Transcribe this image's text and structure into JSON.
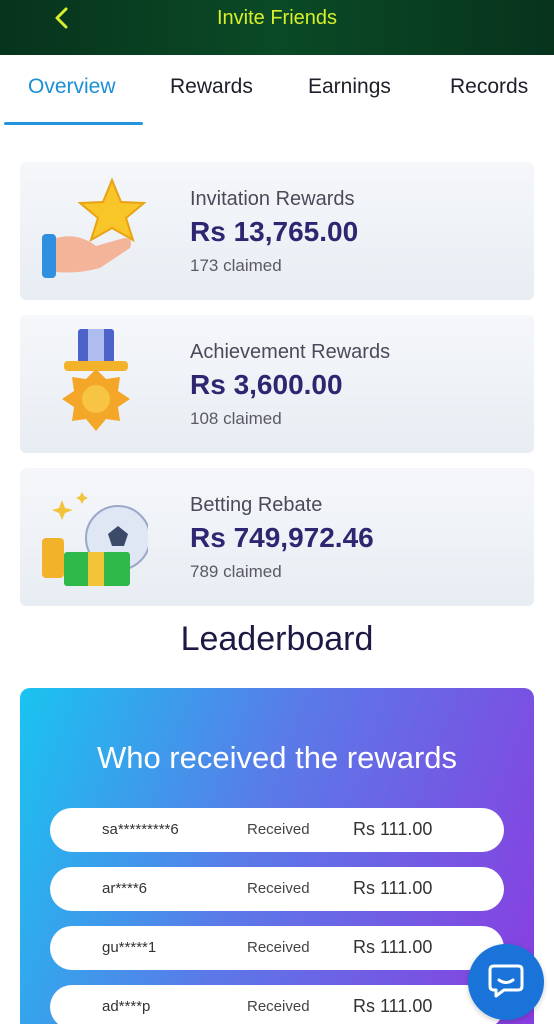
{
  "header": {
    "title": "Invite Friends",
    "back_icon": "chevron-left-icon"
  },
  "tabs": [
    {
      "label": "Overview",
      "active": true
    },
    {
      "label": "Rewards",
      "active": false
    },
    {
      "label": "Earnings",
      "active": false
    },
    {
      "label": "Records",
      "active": false
    }
  ],
  "cards": [
    {
      "title": "Invitation Rewards",
      "amount": "Rs 13,765.00",
      "claimed": "173 claimed",
      "icon": "star-hand-icon"
    },
    {
      "title": "Achievement Rewards",
      "amount": "Rs 3,600.00",
      "claimed": "108 claimed",
      "icon": "medal-icon"
    },
    {
      "title": "Betting Rebate",
      "amount": "Rs 749,972.46",
      "claimed": "789 claimed",
      "icon": "money-ball-icon"
    }
  ],
  "leaderboard": {
    "title": "Leaderboard",
    "heading": "Who received the rewards",
    "rows": [
      {
        "name": "sa*********6",
        "status": "Received",
        "amount": "Rs 111.00"
      },
      {
        "name": "ar****6",
        "status": "Received",
        "amount": "Rs 111.00"
      },
      {
        "name": "gu*****1",
        "status": "Received",
        "amount": "Rs 111.00"
      },
      {
        "name": "ad****p",
        "status": "Received",
        "amount": "Rs 111.00"
      }
    ]
  },
  "colors": {
    "accent": "#1b8fd6",
    "header_text": "#d8ef2b",
    "amount": "#2d2670"
  },
  "chat": {
    "icon": "chat-bubble-icon"
  }
}
